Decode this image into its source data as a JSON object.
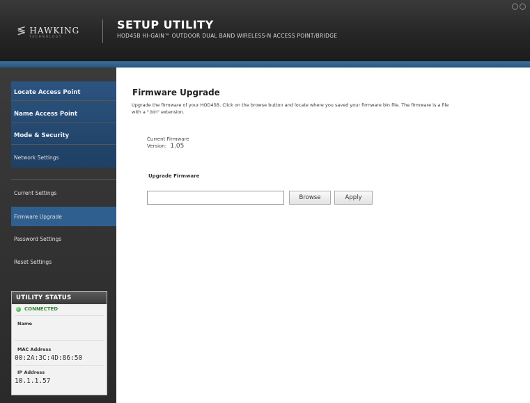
{
  "header": {
    "logo_text": "HAWKING",
    "logo_sub": "TECHNOLOGY",
    "title": "SETUP UTILITY",
    "subtitle": "HOD45B HI-GAIN™ OUTDOOR DUAL BAND WIRELESS-N ACCESS POINT/BRIDGE"
  },
  "sidebar": {
    "primary": [
      {
        "label": "Locate Access Point"
      },
      {
        "label": "Name Access Point"
      },
      {
        "label": "Mode & Security"
      },
      {
        "label": "Network Settings"
      }
    ],
    "secondary": [
      {
        "label": "Current Settings"
      },
      {
        "label": "Firmware Upgrade"
      },
      {
        "label": "Password Settings"
      },
      {
        "label": "Reset Settings"
      }
    ],
    "active_index": 1
  },
  "status": {
    "title": "UTILITY STATUS",
    "connection": "CONNECTED",
    "name_label": "Name",
    "name_value": "",
    "mac_label": "MAC Address",
    "mac_value": "00:2A:3C:4D:86:50",
    "ip_label": "IP Address",
    "ip_value": "10.1.1.57"
  },
  "main": {
    "title": "Firmware Upgrade",
    "description": "Upgrade the firmware of your HOD45B.  Click on the browse button and locate where you saved your firmware bin file.  The firmware is a file with a \".bin\" extension.",
    "current_fw_label": "Current Firmware",
    "version_label": "Version:",
    "version_value": "1.05",
    "upgrade_title": "Upgrade Firmware",
    "file_value": "",
    "browse_label": "Browse",
    "apply_label": "Apply"
  },
  "colors": {
    "accent": "#2f5f8e",
    "connected": "#2f8a2f"
  }
}
